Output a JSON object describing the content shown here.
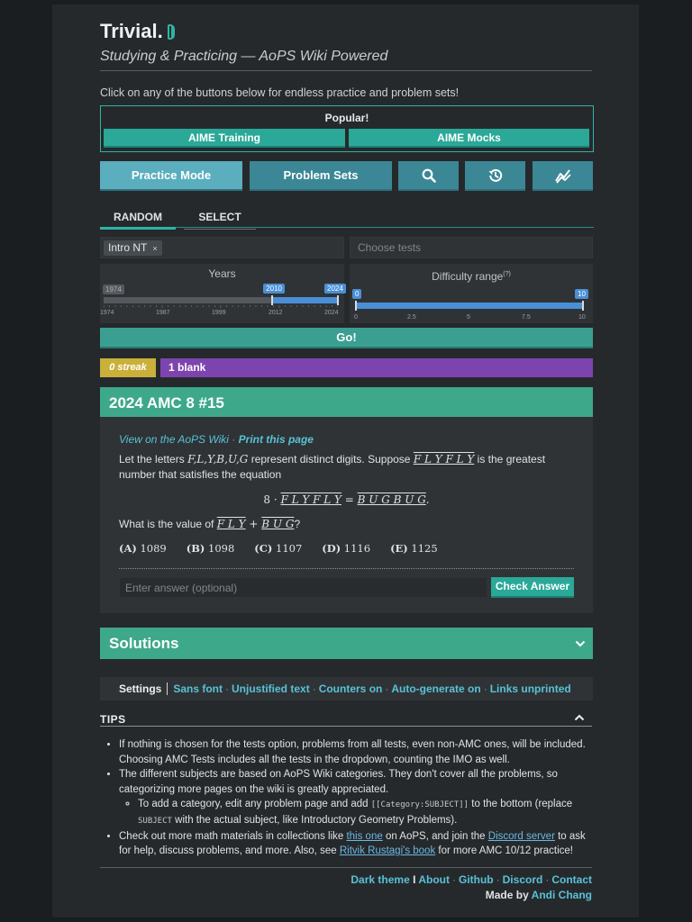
{
  "app": {
    "name": "Trivial.",
    "tagline": "Studying & Practicing — AoPS Wiki Powered",
    "intro": "Click on any of the buttons below for endless practice and problem sets!"
  },
  "popular": {
    "title": "Popular!",
    "buttons": [
      "AIME Training",
      "AIME Mocks"
    ]
  },
  "modes": {
    "practice": "Practice Mode",
    "sets": "Problem Sets",
    "icons": [
      "search-icon",
      "history-icon",
      "stats-icon"
    ]
  },
  "tabs": [
    "RANDOM",
    "SELECT"
  ],
  "filters": {
    "subject_chip": "Intro NT",
    "chip_remove": "×",
    "tests_placeholder": "Choose tests"
  },
  "years": {
    "title": "Years",
    "min": "1974",
    "low": "2010",
    "high": "2024",
    "low_value": 2010,
    "high_value": 2024,
    "range_min": 1974,
    "range_max": 2024,
    "ticks": [
      "1974",
      "1987",
      "1999",
      "2012",
      "2024"
    ]
  },
  "difficulty": {
    "title": "Difficulty range",
    "sup": "(?)",
    "low": "0",
    "high": "10",
    "low_value": 0,
    "high_value": 10,
    "ticks": [
      "0",
      "2.5",
      "5",
      "7.5",
      "10"
    ]
  },
  "go": "Go!",
  "streak": "0 streak",
  "blank": "1 blank",
  "problem": {
    "title": "2024 AMC 8 #15",
    "view_link": "View on the AoPS Wiki",
    "dot": "·",
    "print_link": "Print this page",
    "text_1a": "Let the letters",
    "letters": "F,L,Y,B,U,G",
    "text_1b": "represent distinct digits. Suppose",
    "word1": "F L Y F L Y",
    "text_1c": "is the greatest",
    "text_2": "number that satisfies the equation",
    "eq_prefix": "8 · ",
    "eq_lhs": "F L Y F L Y",
    "eq_mid": " = ",
    "eq_rhs": "B U G B U G",
    "eq_end": ".",
    "q_a": "What is the value of",
    "q_flY": "F L Y",
    "q_plus": " + ",
    "q_bug": "B U G",
    "q_end": "?",
    "choices": [
      {
        "label": "(A)",
        "value": "1089"
      },
      {
        "label": "(B)",
        "value": "1098"
      },
      {
        "label": "(C)",
        "value": "1107"
      },
      {
        "label": "(D)",
        "value": "1116"
      },
      {
        "label": "(E)",
        "value": "1125"
      }
    ],
    "answer_placeholder": "Enter answer (optional)",
    "check": "Check Answer"
  },
  "solutions": "Solutions",
  "settings": {
    "label": "Settings",
    "options": [
      "Sans font",
      "Unjustified text",
      "Counters on",
      "Auto-generate on",
      "Links unprinted"
    ]
  },
  "tips": {
    "title": "TIPS",
    "t1": "If nothing is chosen for the tests option, problems from all tests, even non-AMC ones, will be included. Choosing AMC Tests includes all the tests in the dropdown, counting the IMO as well.",
    "t2": "The different subjects are based on AoPS Wiki categories. They don't cover all the problems, so categorizing more pages on the wiki is greatly appreciated.",
    "t2a_1": "To add a category, edit any problem page and add ",
    "t2a_code": "[[Category:SUBJECT]]",
    "t2a_2": " to the bottom (replace ",
    "t2a_code2": "SUBJECT",
    "t2a_3": " with the actual subject, like Introductory Geometry Problems).",
    "t3_1": "Check out more math materials in collections like ",
    "t3_link1": "this one",
    "t3_2": " on AoPS, and join the ",
    "t3_link2": "Discord server",
    "t3_3": " to ask for help, discuss problems, and more. Also, see ",
    "t3_link3": "Ritvik Rustagi's book",
    "t3_4": " for more AMC 10/12 practice!"
  },
  "footer": {
    "theme": "Dark theme",
    "bar": "I",
    "links": [
      "About",
      "Github",
      "Discord",
      "Contact"
    ],
    "made_by": "Made by",
    "author": "Andi Chang"
  },
  "colors": {
    "accent": "#2fb4a3",
    "header_green": "#3ea88b",
    "streak": "#c9b03a",
    "blank": "#7d44b0",
    "slider": "#4a8fd6"
  }
}
